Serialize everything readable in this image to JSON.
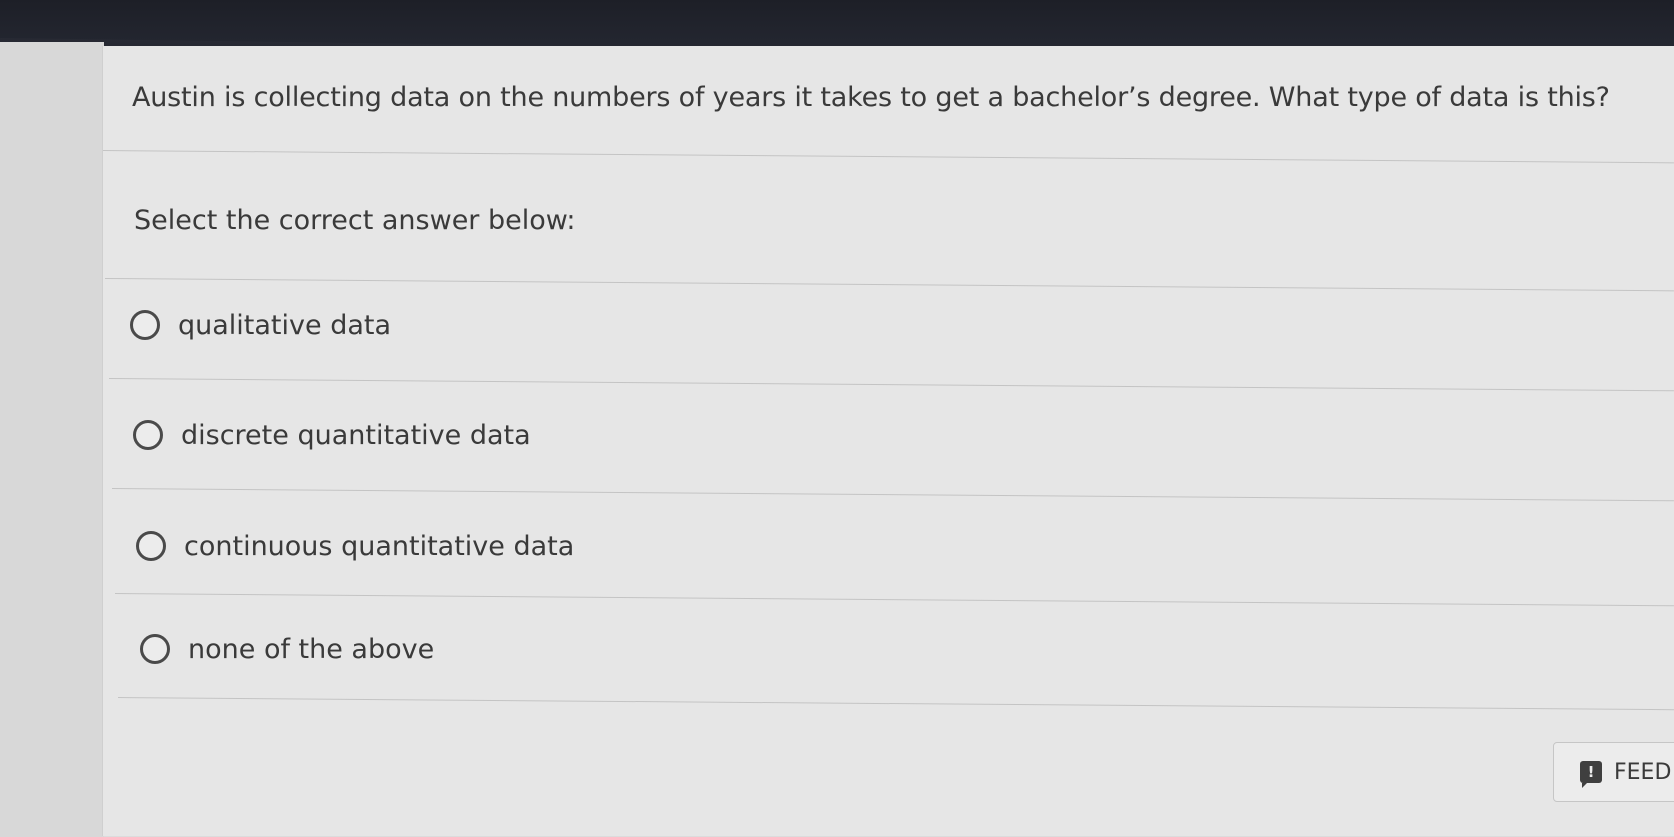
{
  "question": {
    "text": "Austin is collecting data on the numbers of years it takes to get a bachelor’s degree. What type of data is this?",
    "instruction": "Select the correct answer below:"
  },
  "options": [
    {
      "label": "qualitative data",
      "selected": false
    },
    {
      "label": "discrete quantitative data",
      "selected": false
    },
    {
      "label": "continuous quantitative data",
      "selected": false
    },
    {
      "label": "none of the above",
      "selected": false
    }
  ],
  "feedback_button": {
    "label": "FEED",
    "icon": "feedback-icon"
  }
}
